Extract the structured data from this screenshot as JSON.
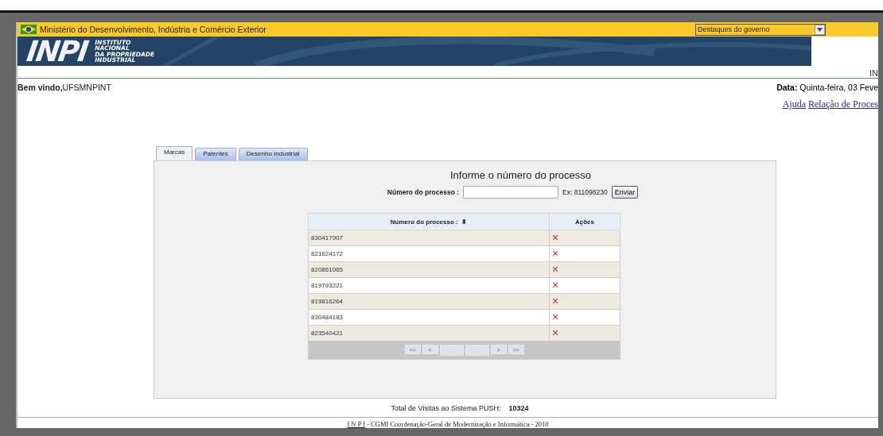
{
  "top_bar": {
    "ministry": "Ministério do Desenvolvimento, Indústria e Comércio Exterior",
    "select": {
      "value": "Destaques do governo"
    }
  },
  "banner": {
    "logo": "INPI",
    "institute": [
      "INSTITUTO",
      "NACIONAL",
      "DA PROPRIEDADE",
      "INDUSTRIAL"
    ],
    "cut_text": "IN"
  },
  "welcome": {
    "label": "Bem vindo,",
    "user": "UFSMNPINT"
  },
  "date": {
    "label": "Data:",
    "value": "Quinta-feira, 03 Feve"
  },
  "links": [
    "Ajuda",
    "Relação de Proces"
  ],
  "tabs": [
    {
      "label": "Marcas",
      "selected": true
    },
    {
      "label": "Patentes",
      "selected": false
    },
    {
      "label": "Desenho Industrial",
      "selected": false
    }
  ],
  "form": {
    "title": "Informe o número do processo",
    "label": "Número do processo :",
    "example": "Ex: 811098230",
    "button": "Enviar"
  },
  "table": {
    "columns": [
      "Número do processo :",
      "Ações"
    ],
    "sort_mark": "⬍",
    "rows": [
      {
        "number": "830417907",
        "action": "×"
      },
      {
        "number": "821624172",
        "action": "×"
      },
      {
        "number": "820861065",
        "action": "×"
      },
      {
        "number": "819793221",
        "action": "×"
      },
      {
        "number": "819816264",
        "action": "×"
      },
      {
        "number": "830484183",
        "action": "×"
      },
      {
        "number": "823540421",
        "action": "×"
      }
    ],
    "pager": [
      {
        "kind": "button",
        "label": "<<",
        "disabled": true
      },
      {
        "kind": "button",
        "label": "<",
        "disabled": true
      },
      {
        "kind": "blank",
        "disabled": true
      },
      {
        "kind": "blank",
        "disabled": true
      },
      {
        "kind": "button",
        "label": ">",
        "disabled": true
      },
      {
        "kind": "button",
        "label": ">>",
        "disabled": true
      }
    ]
  },
  "visits": {
    "label": "Total de Visitas ao Sistema PUSH:",
    "count": "10324"
  },
  "footer": {
    "link": "I N P I",
    "text": " - CGMI Coordenação-Geral de Modernização e Informática - 2010"
  }
}
